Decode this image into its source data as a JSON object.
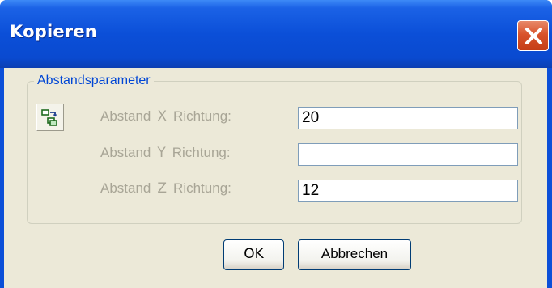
{
  "window": {
    "title": "Kopieren"
  },
  "group": {
    "legend": "Abstandsparameter"
  },
  "rows": [
    {
      "prefix": "Abstand",
      "axis": "X",
      "suffix": "Richtung:",
      "value": "20"
    },
    {
      "prefix": "Abstand",
      "axis": "Y",
      "suffix": "Richtung:",
      "value": ""
    },
    {
      "prefix": "Abstand",
      "axis": "Z",
      "suffix": "Richtung:",
      "value": "12"
    }
  ],
  "buttons": {
    "ok": "OK",
    "cancel": "Abbrechen"
  },
  "icons": {
    "close": "close-icon",
    "copy": "copy-objects-icon"
  },
  "colors": {
    "titlebar": "#0b4fd8",
    "legend": "#0046d5",
    "close": "#d9532b",
    "dialog": "#ece9d8"
  }
}
